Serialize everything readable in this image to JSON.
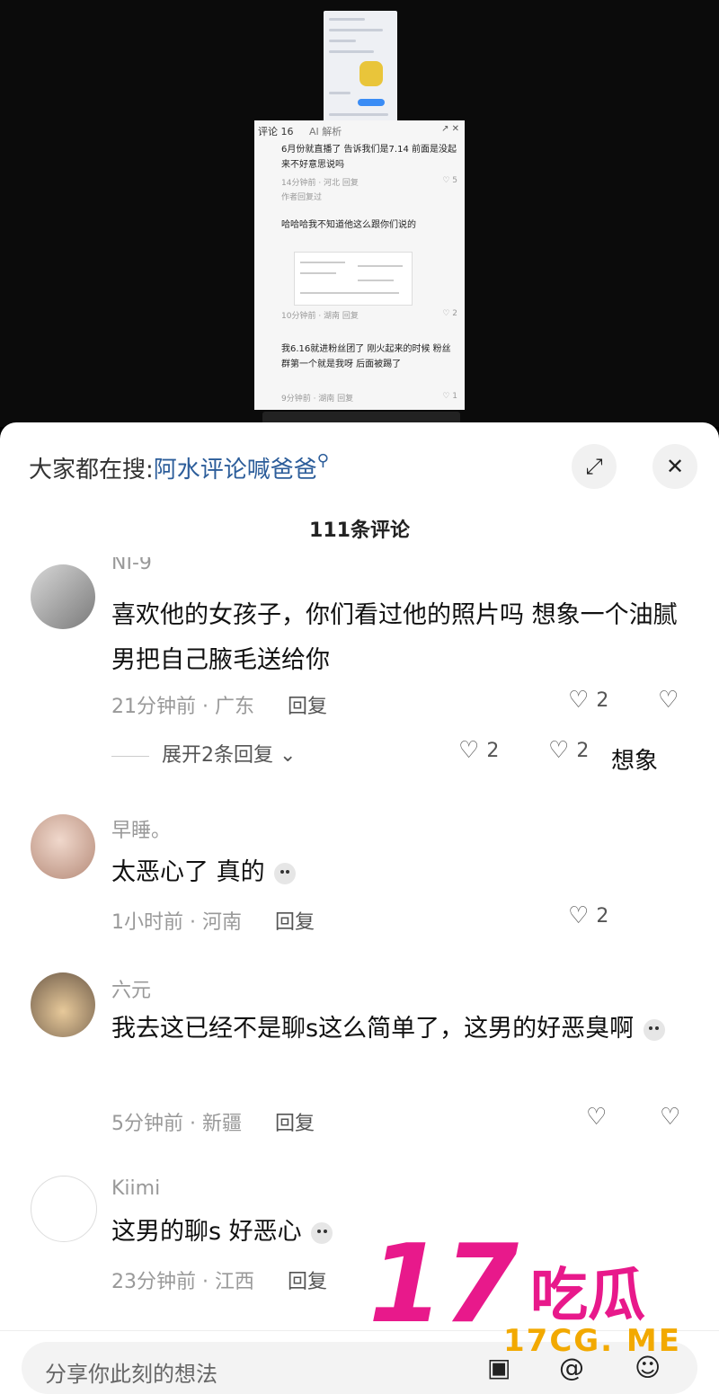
{
  "video_preview": {
    "comment_screenshot": {
      "tab_label": "评论 16",
      "ai_label": "AI 解析",
      "items": [
        {
          "text": "6月份就直播了 告诉我们是7.14 前面是没起来不好意思说吗",
          "meta": "14分钟前 · 河北  回复",
          "likes": "5"
        },
        {
          "text": "作者回复过",
          "meta": "",
          "likes": ""
        },
        {
          "text": "哈哈哈我不知道他这么跟你们说的",
          "meta": "10分钟前 · 湖南  回复",
          "likes": "2"
        },
        {
          "text": "我6.16就进粉丝团了 刚火起来的时候 粉丝群第一个就是我呀 后面被踢了",
          "meta": "9分钟前 · 湖南  回复",
          "likes": "1"
        }
      ]
    }
  },
  "header": {
    "search_prefix": "大家都在搜:",
    "search_keyword": "阿水评论喊爸爸",
    "search_icon_glyph": "⚲",
    "expand_icon": "expand-icon",
    "close_icon": "close-icon"
  },
  "comment_count": "111条评论",
  "comments": [
    {
      "username": "NI-9",
      "text": "喜欢他的女孩子，你们看过他的照片吗 想象一个油腻男把自己腋毛送给你",
      "time_location": "21分钟前 · 广东",
      "reply_label": "回复",
      "likes": "2",
      "expand_label": "展开2条回复",
      "expand_likes": "2",
      "expand_dislikes": "2",
      "overlap_text": "想象"
    },
    {
      "username": "早睡。",
      "text": "太恶心了 真的",
      "time_location": "1小时前 · 河南",
      "reply_label": "回复",
      "likes": "2"
    },
    {
      "username": "六元",
      "text": "我去这已经不是聊s这么简单了，这男的好恶臭啊",
      "time_location": "5分钟前 · 新疆",
      "reply_label": "回复",
      "likes": ""
    },
    {
      "username": "Kiimi",
      "text": "这男的聊s 好恶心",
      "time_location": "23分钟前 · 江西",
      "reply_label": "回复",
      "likes": ""
    }
  ],
  "input": {
    "placeholder": "分享你此刻的想法",
    "icons": [
      "image-icon",
      "at-icon",
      "emoji-icon"
    ]
  },
  "watermark": {
    "number": "17",
    "chinese": "吃瓜",
    "url": "17CG. ME"
  },
  "colors": {
    "keyword_blue": "#2c5d9a",
    "watermark_pink": "#e8198b",
    "watermark_orange": "#f2a900"
  }
}
